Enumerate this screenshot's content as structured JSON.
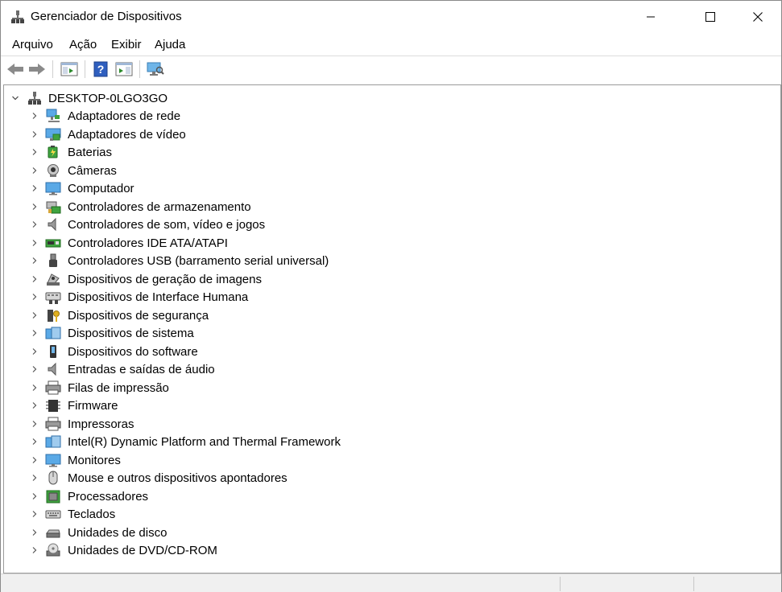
{
  "window": {
    "title": "Gerenciador de Dispositivos"
  },
  "menu": [
    "Arquivo",
    "Ação",
    "Exibir",
    "Ajuda"
  ],
  "toolbar": [
    "back-icon",
    "forward-icon",
    "properties-pane-icon",
    "help-icon",
    "action-pane-icon",
    "scan-hardware-icon"
  ],
  "tree": {
    "root": "DESKTOP-0LGO3GO",
    "items": [
      {
        "label": "Adaptadores de rede",
        "icon": "network-adapter-icon"
      },
      {
        "label": "Adaptadores de vídeo",
        "icon": "display-adapter-icon"
      },
      {
        "label": "Baterias",
        "icon": "battery-icon"
      },
      {
        "label": "Câmeras",
        "icon": "camera-icon"
      },
      {
        "label": "Computador",
        "icon": "computer-icon"
      },
      {
        "label": "Controladores de armazenamento",
        "icon": "storage-controller-icon"
      },
      {
        "label": "Controladores de som, vídeo e jogos",
        "icon": "sound-icon"
      },
      {
        "label": "Controladores IDE ATA/ATAPI",
        "icon": "ide-controller-icon"
      },
      {
        "label": "Controladores USB (barramento serial universal)",
        "icon": "usb-icon"
      },
      {
        "label": "Dispositivos de geração de imagens",
        "icon": "imaging-device-icon"
      },
      {
        "label": "Dispositivos de Interface Humana",
        "icon": "hid-icon"
      },
      {
        "label": "Dispositivos de segurança",
        "icon": "security-device-icon"
      },
      {
        "label": "Dispositivos de sistema",
        "icon": "system-device-icon"
      },
      {
        "label": "Dispositivos do software",
        "icon": "software-device-icon"
      },
      {
        "label": "Entradas e saídas de áudio",
        "icon": "audio-io-icon"
      },
      {
        "label": "Filas de impressão",
        "icon": "print-queue-icon"
      },
      {
        "label": "Firmware",
        "icon": "firmware-icon"
      },
      {
        "label": "Impressoras",
        "icon": "printer-icon"
      },
      {
        "label": "Intel(R) Dynamic Platform and Thermal Framework",
        "icon": "thermal-framework-icon"
      },
      {
        "label": "Monitores",
        "icon": "monitor-icon"
      },
      {
        "label": "Mouse e outros dispositivos apontadores",
        "icon": "mouse-icon"
      },
      {
        "label": "Processadores",
        "icon": "processor-icon"
      },
      {
        "label": "Teclados",
        "icon": "keyboard-icon"
      },
      {
        "label": "Unidades de disco",
        "icon": "disk-drive-icon"
      },
      {
        "label": "Unidades de DVD/CD-ROM",
        "icon": "dvd-drive-icon"
      }
    ]
  }
}
